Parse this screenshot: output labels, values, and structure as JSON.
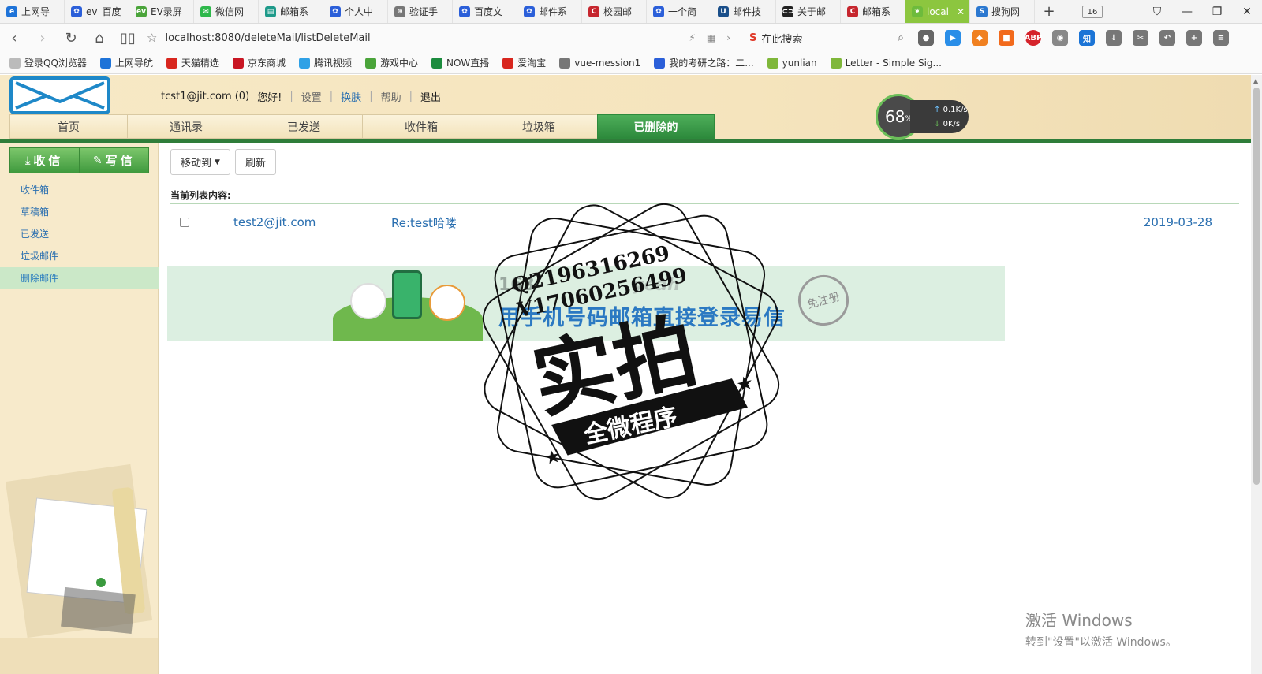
{
  "browser": {
    "tabs": [
      {
        "label": "上网导",
        "color": "#1e73d8",
        "glyph": "e"
      },
      {
        "label": "ev_百度",
        "color": "#2b5fd9",
        "glyph": "✿"
      },
      {
        "label": "EV录屏",
        "color": "#4aa43a",
        "glyph": "ev"
      },
      {
        "label": "微信网",
        "color": "#2eb84b",
        "glyph": "✉"
      },
      {
        "label": "邮箱系",
        "color": "#1e9a8a",
        "glyph": "▤"
      },
      {
        "label": "个人中",
        "color": "#2b5fd9",
        "glyph": "✿"
      },
      {
        "label": "验证手",
        "color": "#777777",
        "glyph": "⊕"
      },
      {
        "label": "百度文",
        "color": "#2b5fd9",
        "glyph": "✿"
      },
      {
        "label": "邮件系",
        "color": "#2b5fd9",
        "glyph": "✿"
      },
      {
        "label": "校园邮",
        "color": "#c6262e",
        "glyph": "C"
      },
      {
        "label": "一个简",
        "color": "#2b5fd9",
        "glyph": "✿"
      },
      {
        "label": "邮件技",
        "color": "#1a4f8a",
        "glyph": "U"
      },
      {
        "label": "关于邮",
        "color": "#222222",
        "glyph": "⊂⊃"
      },
      {
        "label": "邮箱系",
        "color": "#c6262e",
        "glyph": "C"
      },
      {
        "label": "local",
        "color": "#6dbb3c",
        "glyph": "❦",
        "active": true
      },
      {
        "label": "搜狗网",
        "color": "#2b78d0",
        "glyph": "S"
      }
    ],
    "tab_count": "16",
    "url": "localhost:8080/deleteMail/listDeleteMail",
    "search_placeholder": "在此搜索",
    "bookmarks": [
      {
        "label": "登录QQ浏览器",
        "color": "#bbbbbb"
      },
      {
        "label": "上网导航",
        "color": "#1e73d8"
      },
      {
        "label": "天猫精选",
        "color": "#d8261e"
      },
      {
        "label": "京东商城",
        "color": "#c91623"
      },
      {
        "label": "腾讯视频",
        "color": "#2fa1e6"
      },
      {
        "label": "游戏中心",
        "color": "#4aa43a"
      },
      {
        "label": "NOW直播",
        "color": "#1c8c3e"
      },
      {
        "label": "爱淘宝",
        "color": "#d8261e"
      },
      {
        "label": "vue-mession1",
        "color": "#777777"
      },
      {
        "label": "我的考研之路：二...",
        "color": "#2b5fd9"
      },
      {
        "label": "yunlian",
        "color": "#7fb73a"
      },
      {
        "label": "Letter - Simple Sig...",
        "color": "#7fb73a"
      }
    ]
  },
  "header": {
    "user": "tcst1@jit.com (0)",
    "greeting": "您好!",
    "links": {
      "settings": "设置",
      "skin": "换肤",
      "help": "帮助",
      "logout": "退出"
    },
    "nav": [
      "首页",
      "通讯录",
      "已发送",
      "收件箱",
      "垃圾箱",
      "已删除的"
    ],
    "active_nav": 5
  },
  "speed_widget": {
    "percent": "68",
    "unit": "%",
    "up": "0.1K/s",
    "down": "0K/s"
  },
  "sidebar": {
    "receive_label": "收信",
    "compose_label": "写信",
    "items": [
      "收件箱",
      "草稿箱",
      "已发送",
      "垃圾邮件",
      "删除邮件"
    ],
    "active_item": 4
  },
  "toolbar": {
    "move_label": "移动到",
    "refresh_label": "刷新"
  },
  "list": {
    "caption": "当前列表内容:",
    "rows": [
      {
        "from": "test2@jit.com",
        "subject": "Re:test哈喽",
        "date": "2019-03-28"
      }
    ]
  },
  "banner": {
    "brand1": "163",
    "brand2": "yeah",
    "slogan": "用手机号码邮箱直接登录易信",
    "stamp": "免注册"
  },
  "watermark": {
    "line1": "Q2196316269",
    "line2": "V17060256499",
    "big": "实拍",
    "ribbon": "全微程序"
  },
  "windows_activation": {
    "line1": "激活 Windows",
    "line2": "转到\"设置\"以激活 Windows。"
  }
}
